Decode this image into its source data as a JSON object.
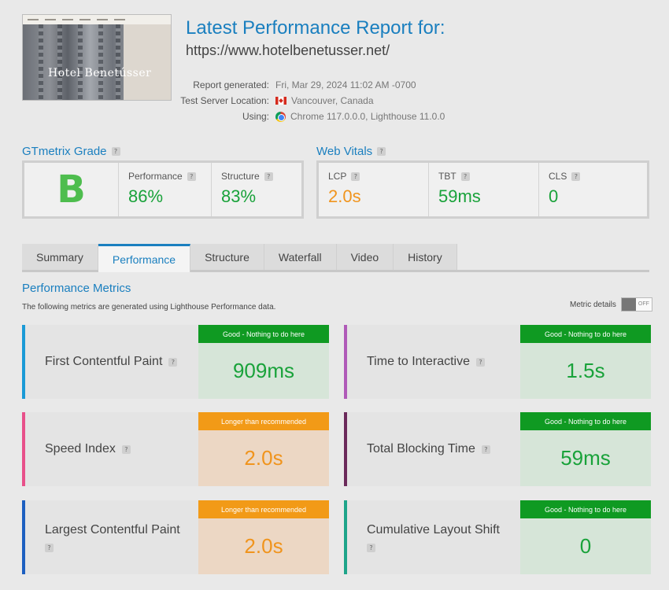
{
  "header": {
    "title": "Latest Performance Report for:",
    "url": "https://www.hotelbenetusser.net/",
    "thumbnail_text": "Hotel Benetússer"
  },
  "meta": {
    "report_generated_label": "Report generated:",
    "report_generated_value": "Fri, Mar 29, 2024 11:02 AM -0700",
    "location_label": "Test Server Location:",
    "location_value": "Vancouver, Canada",
    "using_label": "Using:",
    "using_value": "Chrome 117.0.0.0, Lighthouse 11.0.0"
  },
  "grade": {
    "heading": "GTmetrix Grade",
    "letter": "B",
    "performance_label": "Performance",
    "performance_value": "86%",
    "structure_label": "Structure",
    "structure_value": "83%"
  },
  "vitals": {
    "heading": "Web Vitals",
    "lcp_label": "LCP",
    "lcp_value": "2.0s",
    "tbt_label": "TBT",
    "tbt_value": "59ms",
    "cls_label": "CLS",
    "cls_value": "0"
  },
  "tabs": [
    {
      "label": "Summary"
    },
    {
      "label": "Performance"
    },
    {
      "label": "Structure"
    },
    {
      "label": "Waterfall"
    },
    {
      "label": "Video"
    },
    {
      "label": "History"
    }
  ],
  "metrics_section": {
    "title": "Performance Metrics",
    "description": "The following metrics are generated using Lighthouse Performance data.",
    "details_label": "Metric details",
    "toggle_label": "OFF"
  },
  "metrics": [
    {
      "name": "First Contentful Paint",
      "status": "Good - Nothing to do here",
      "value": "909ms",
      "color": "#1a9ad6"
    },
    {
      "name": "Time to Interactive",
      "status": "Good - Nothing to do here",
      "value": "1.5s",
      "color": "#b05ab8"
    },
    {
      "name": "Speed Index",
      "status": "Longer than recommended",
      "value": "2.0s",
      "color": "#e8508a"
    },
    {
      "name": "Total Blocking Time",
      "status": "Good - Nothing to do here",
      "value": "59ms",
      "color": "#6b2a5a"
    },
    {
      "name": "Largest Contentful Paint",
      "status": "Longer than recommended",
      "value": "2.0s",
      "color": "#1c5fc0"
    },
    {
      "name": "Cumulative Layout Shift",
      "status": "Good - Nothing to do here",
      "value": "0",
      "color": "#1ea58a"
    }
  ],
  "help_icon_glyph": "?"
}
